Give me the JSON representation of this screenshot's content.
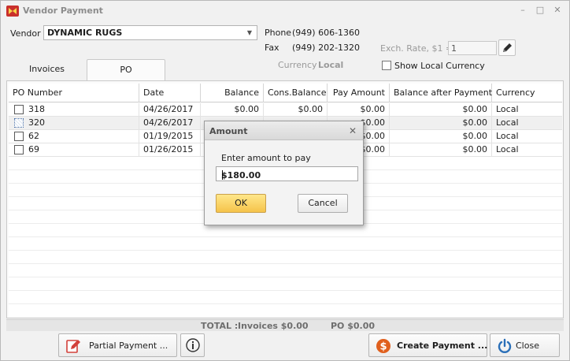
{
  "window": {
    "title": "Vendor Payment",
    "controls": [
      "–",
      "□",
      "✕"
    ]
  },
  "vendor": {
    "label": "Vendor",
    "value": "DYNAMIC RUGS",
    "phone_label": "Phone",
    "phone": "(949) 606-1360",
    "fax_label": "Fax",
    "fax": "(949) 202-1320",
    "currency_label": "Currency",
    "currency": "Local",
    "exch_rate_label": "Exch. Rate, $1 =",
    "exch_rate_value": "1",
    "show_local_currency_label": "Show Local Currency",
    "show_local_currency_checked": false
  },
  "tabs": [
    {
      "label": "Invoices",
      "active": false
    },
    {
      "label": "PO",
      "active": true
    }
  ],
  "grid": {
    "columns": [
      "PO Number",
      "Date",
      "Balance",
      "Cons.Balance",
      "Pay Amount",
      "Balance after Payment",
      "Currency"
    ],
    "rows": [
      {
        "po": "318",
        "date": "04/26/2017",
        "balance": "$0.00",
        "cons_balance": "$0.00",
        "pay_amount": "$0.00",
        "balance_after": "$0.00",
        "currency": "Local"
      },
      {
        "po": "320",
        "date": "04/26/2017",
        "balance": "",
        "cons_balance": "",
        "pay_amount": "$0.00",
        "balance_after": "$0.00",
        "currency": "Local"
      },
      {
        "po": "62",
        "date": "01/19/2015",
        "balance": "",
        "cons_balance": "",
        "pay_amount": "$0.00",
        "balance_after": "$0.00",
        "currency": "Local"
      },
      {
        "po": "69",
        "date": "01/26/2015",
        "balance": "",
        "cons_balance": "",
        "pay_amount": "$0.00",
        "balance_after": "$0.00",
        "currency": "Local"
      }
    ]
  },
  "totals": {
    "label": "TOTAL :",
    "invoices": "Invoices $0.00",
    "po": "PO $0.00"
  },
  "buttons": {
    "partial_payment": "Partial Payment ...",
    "info_icon": "info-icon",
    "create_payment": "Create Payment ...",
    "close": "Close"
  },
  "dialog": {
    "title": "Amount",
    "prompt": "Enter amount to pay",
    "value": "$180.00",
    "ok": "OK",
    "cancel": "Cancel"
  },
  "colors": {
    "ok_button": "#f5c34a",
    "create_payment_icon": "#e0601e",
    "close_icon": "#2a6fb8"
  }
}
